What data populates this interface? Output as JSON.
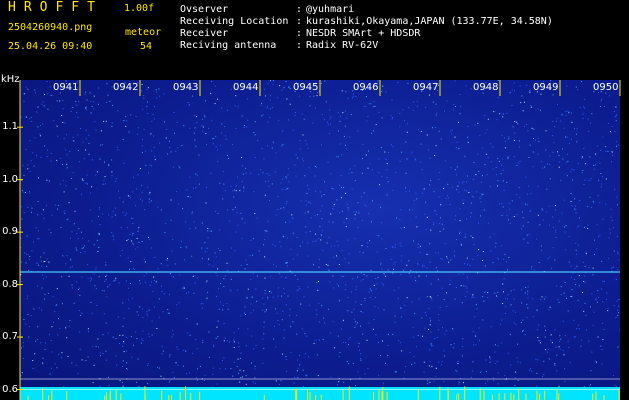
{
  "header": {
    "app_title": "HROFFT",
    "version": "1.00f",
    "filename": "2504260940.png",
    "datetime": "25.04.26 09:40",
    "meteor_label": "meteor",
    "meteor_count": "54",
    "info": [
      {
        "label": "Ovserver",
        "value": "@yuhmari"
      },
      {
        "label": "Receiving Location",
        "value": "kurashiki,Okayama,JAPAN (133.77E, 34.58N)"
      },
      {
        "label": "Receiver",
        "value": "NESDR SMArt + HDSDR"
      },
      {
        "label": "Reciving antenna",
        "value": "Radix RV-62V"
      }
    ],
    "separator": ":"
  },
  "colors": {
    "accent_yellow": "#ffe600",
    "background": "#08157a",
    "bottom_band": "#00e5ff",
    "text": "#ffffff"
  },
  "chart_data": {
    "type": "heatmap",
    "unit": "kHz",
    "x_ticks": [
      "0941",
      "0942",
      "0943",
      "0944",
      "0945",
      "0946",
      "0947",
      "0948",
      "0949",
      "0950"
    ],
    "y_ticks": [
      "1.1",
      "1.0",
      "0.9",
      "0.8",
      "0.7",
      "0.6"
    ],
    "y_range": [
      0.58,
      1.19
    ],
    "carrier_frequency": 0.824
  }
}
